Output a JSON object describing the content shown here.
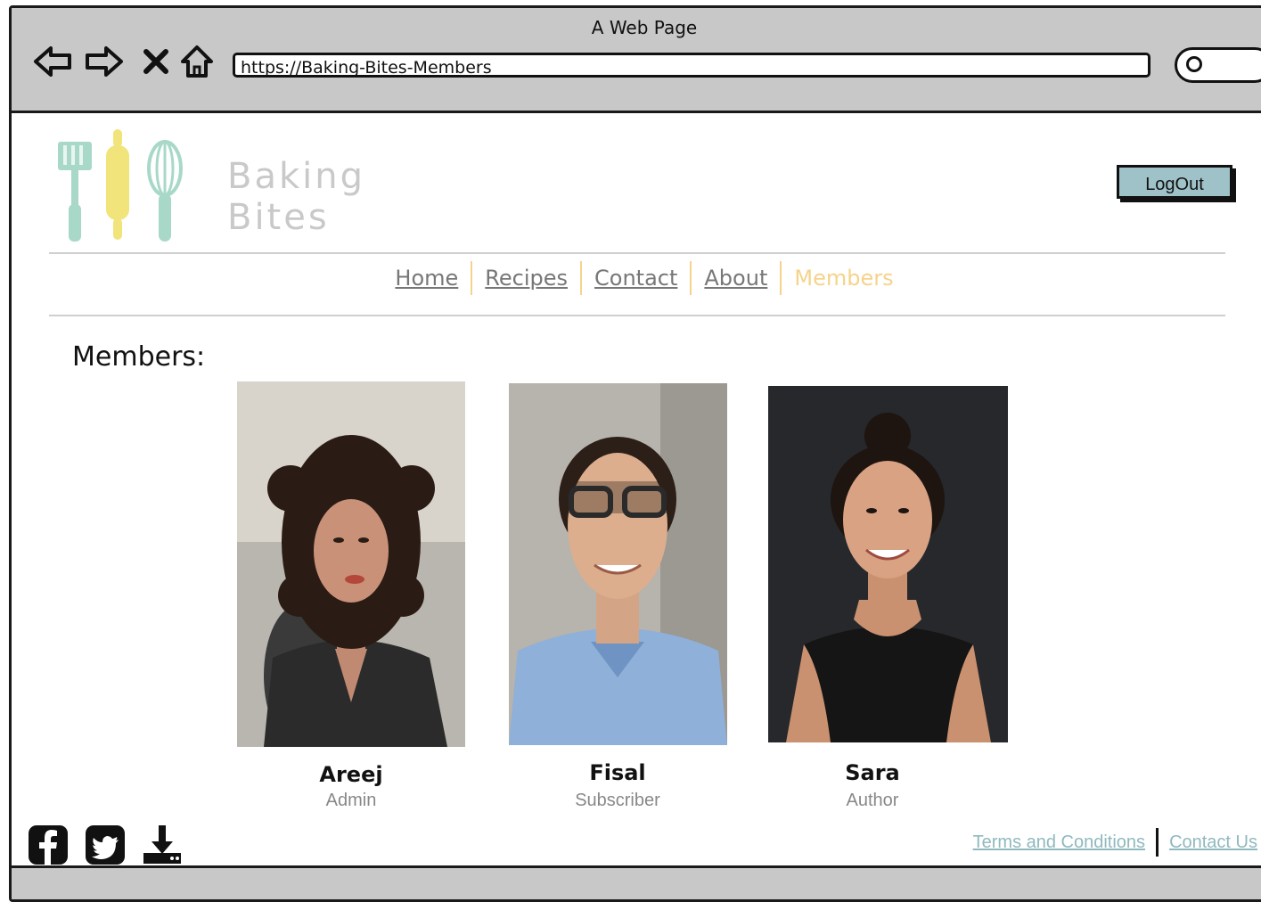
{
  "window": {
    "title": "A Web Page"
  },
  "browser": {
    "url": "https://Baking-Bites-Members"
  },
  "brand": {
    "line1": "Baking",
    "line2": "Bites"
  },
  "header": {
    "logout_label": "LogOut"
  },
  "nav": {
    "items": [
      {
        "label": "Home"
      },
      {
        "label": "Recipes"
      },
      {
        "label": "Contact"
      },
      {
        "label": "About"
      },
      {
        "label": "Members"
      }
    ],
    "active": "Members"
  },
  "page": {
    "heading": "Members:"
  },
  "members": [
    {
      "name": "Areej",
      "role": "Admin"
    },
    {
      "name": "Fisal",
      "role": "Subscriber"
    },
    {
      "name": "Sara",
      "role": "Author"
    }
  ],
  "footer": {
    "social_icons": [
      "facebook-icon",
      "twitter-icon",
      "download-icon"
    ],
    "links": [
      {
        "label": "Terms and Conditions"
      },
      {
        "label": "Contact Us"
      }
    ]
  },
  "colors": {
    "accent": "#f5d38b",
    "button": "#9fc2c8",
    "link": "#8fb9bf",
    "logo_mint": "#a8d8c8",
    "logo_yellow": "#f1e47a"
  }
}
